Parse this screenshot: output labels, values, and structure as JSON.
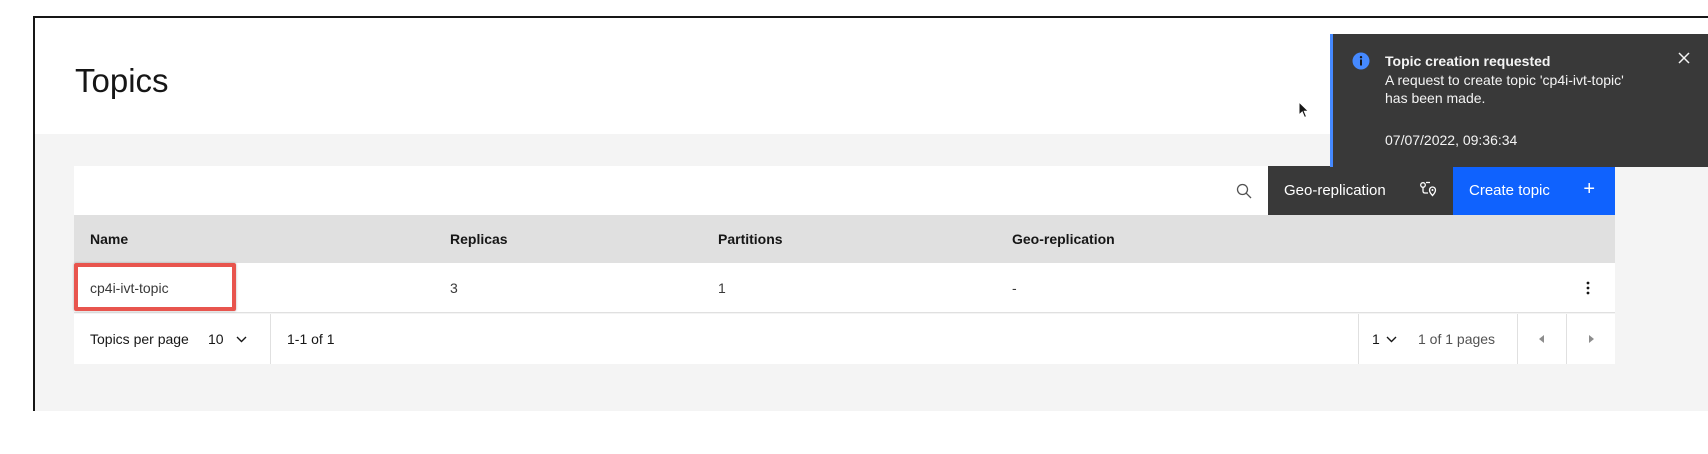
{
  "page": {
    "title": "Topics"
  },
  "toolbar": {
    "search_icon": "search-icon",
    "geo_replication_label": "Geo-replication",
    "geo_replication_icon": "geo-replication-icon",
    "create_topic_label": "Create topic",
    "create_topic_icon": "+"
  },
  "table": {
    "columns": [
      "Name",
      "Replicas",
      "Partitions",
      "Geo-replication"
    ],
    "rows": [
      {
        "name": "cp4i-ivt-topic",
        "replicas": "3",
        "partitions": "1",
        "geo_replication": "-"
      }
    ]
  },
  "pagination": {
    "per_page_label": "Topics per page",
    "per_page_value": "10",
    "range": "1-1 of 1",
    "page_value": "1",
    "page_total": "1 of 1 pages"
  },
  "notification": {
    "title": "Topic creation requested",
    "subtitle": "A request to create topic 'cp4i-ivt-topic' has been made.",
    "timestamp": "07/07/2022, 09:36:34"
  },
  "colors": {
    "accent": "#0f62fe",
    "toast_bg": "#393939",
    "toast_border": "#4589ff",
    "highlight": "#e8554e"
  }
}
